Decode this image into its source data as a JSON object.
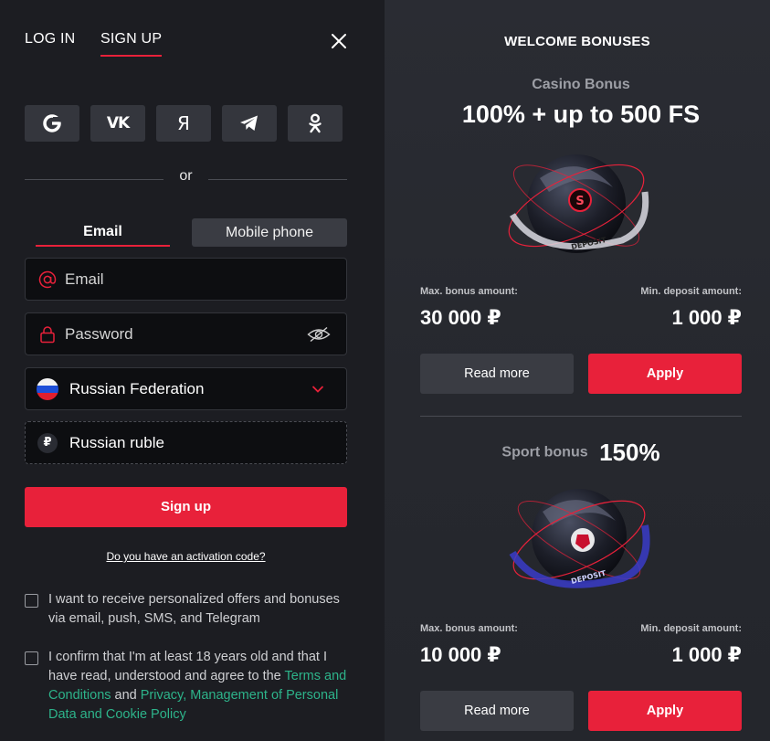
{
  "auth": {
    "tabs": {
      "login": "LOG IN",
      "signup": "SIGN UP"
    },
    "socials": [
      "google-icon",
      "vk-icon",
      "yandex-icon",
      "telegram-icon",
      "odnoklassniki-icon"
    ],
    "social_labels": {
      "vk": "VK",
      "yandex": "Я"
    },
    "or_text": "or",
    "method_tabs": {
      "email": "Email",
      "phone": "Mobile phone"
    },
    "fields": {
      "email_placeholder": "Email",
      "password_placeholder": "Password",
      "country": "Russian Federation",
      "currency_symbol": "₽",
      "currency": "Russian ruble"
    },
    "signup_button": "Sign up",
    "activation_link": "Do you have an activation code?",
    "consents": {
      "offers": "I want to receive personalized offers and bonuses via email, push, SMS, and Telegram",
      "age_prefix": "I confirm that I'm at least 18 years old and that I have read, understood and agree to the ",
      "terms_link": "Terms and Conditions",
      "and": " and ",
      "privacy_link": "Privacy, Management of Personal Data and Cookie Policy"
    }
  },
  "bonuses": {
    "title": "WELCOME BONUSES",
    "casino": {
      "subtitle": "Casino Bonus",
      "headline": "100% + up to 500 FS",
      "max_label": "Max. bonus amount:",
      "max_value": "30 000 ₽",
      "min_label": "Min. deposit amount:",
      "min_value": "1 000 ₽",
      "read_more": "Read more",
      "apply": "Apply"
    },
    "sport": {
      "subtitle": "Sport bonus",
      "headline": "150%",
      "max_label": "Max. bonus amount:",
      "max_value": "10 000 ₽",
      "min_label": "Min. deposit amount:",
      "min_value": "1 000 ₽",
      "read_more": "Read more",
      "apply": "Apply"
    },
    "orb_text": "DEPOSIT",
    "casino_orb_badge": "S"
  },
  "colors": {
    "accent": "#e8213a",
    "link": "#2db38a",
    "panel": "#1c1d22",
    "field": "#0d0e11"
  }
}
